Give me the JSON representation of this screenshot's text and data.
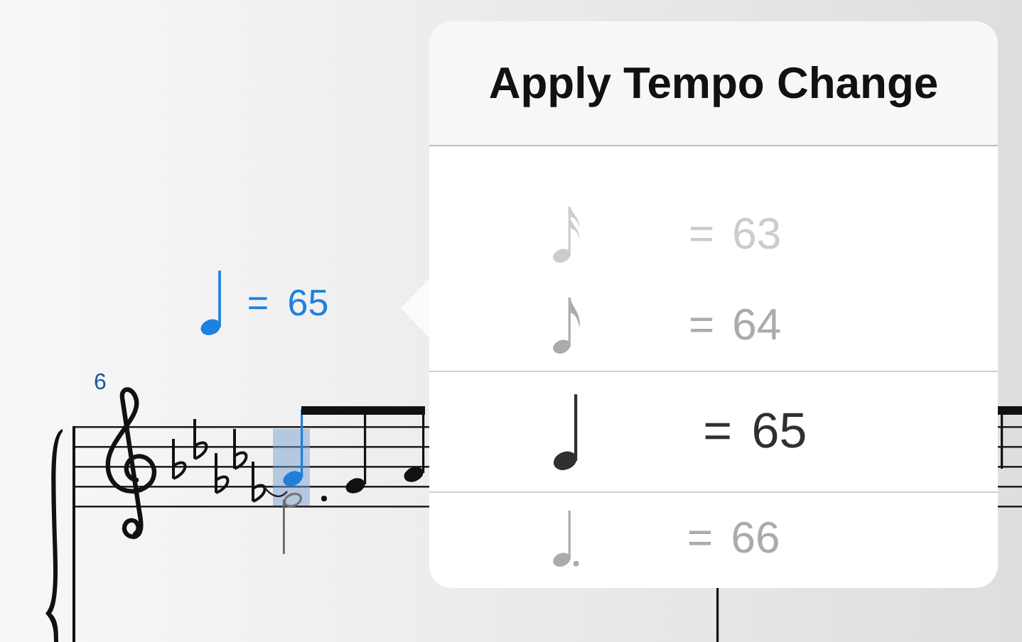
{
  "score": {
    "measure_number": "6",
    "tempo_mark": {
      "kind": "quarter",
      "text": "= 65"
    }
  },
  "popover": {
    "title": "Apply Tempo Change",
    "picker": [
      {
        "kind": "sixteenth",
        "text": "= 63",
        "selected": false
      },
      {
        "kind": "eighth",
        "text": "= 64",
        "selected": false
      },
      {
        "kind": "quarter",
        "text": "= 65",
        "selected": true
      },
      {
        "kind": "dotted-quarter",
        "text": "= 66",
        "selected": false
      }
    ]
  }
}
